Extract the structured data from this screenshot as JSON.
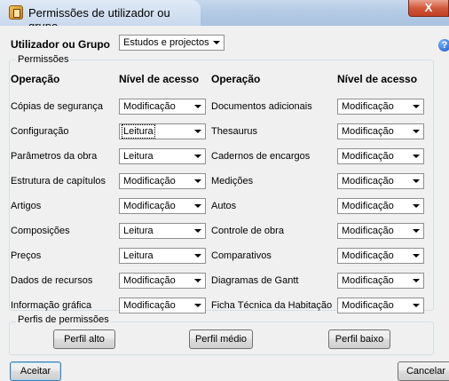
{
  "window": {
    "title": "Permissões de utilizador ou grupo",
    "close_label": "X"
  },
  "user_group": {
    "label": "Utilizador ou Grupo",
    "selected": "Estudos e projectos"
  },
  "help_label": "?",
  "permissions": {
    "group_label": "Permissões",
    "col_operation": "Operação",
    "col_level": "Nível de acesso",
    "left": [
      {
        "op": "Cópias de segurança",
        "level": "Modificação"
      },
      {
        "op": "Configuração",
        "level": "Leitura"
      },
      {
        "op": "Parâmetros da obra",
        "level": "Leitura"
      },
      {
        "op": "Estrutura de capítulos",
        "level": "Modificação"
      },
      {
        "op": "Artigos",
        "level": "Modificação"
      },
      {
        "op": "Composições",
        "level": "Leitura"
      },
      {
        "op": "Preços",
        "level": "Leitura"
      },
      {
        "op": "Dados de recursos",
        "level": "Modificação"
      },
      {
        "op": "Informação gráfica",
        "level": "Modificação"
      }
    ],
    "right": [
      {
        "op": "Documentos adicionais",
        "level": "Modificação"
      },
      {
        "op": "Thesaurus",
        "level": "Modificação"
      },
      {
        "op": "Cadernos de encargos",
        "level": "Modificação"
      },
      {
        "op": "Medições",
        "level": "Modificação"
      },
      {
        "op": "Autos",
        "level": "Modificação"
      },
      {
        "op": "Controle de obra",
        "level": "Modificação"
      },
      {
        "op": "Comparativos",
        "level": "Modificação"
      },
      {
        "op": "Diagramas de Gantt",
        "level": "Modificação"
      },
      {
        "op": "Ficha Técnica da Habitação",
        "level": "Modificação"
      }
    ]
  },
  "profiles": {
    "group_label": "Perfis de permissões",
    "high": "Perfil alto",
    "medium": "Perfil médio",
    "low": "Perfil baixo"
  },
  "footer": {
    "accept": "Aceitar",
    "cancel": "Cancelar"
  }
}
